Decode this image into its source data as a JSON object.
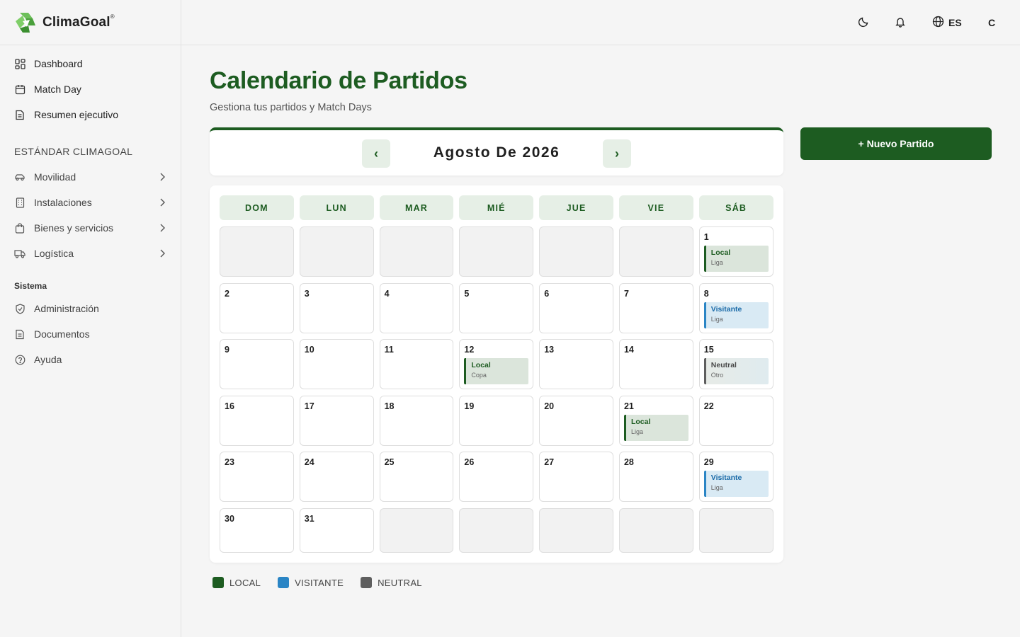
{
  "app": {
    "name": "ClimaGoal",
    "reg_mark": "®"
  },
  "colors": {
    "brand_green": "#1d5c21",
    "local": "#1d5c21",
    "visitante": "#2a85c5",
    "neutral": "#5e5e5e"
  },
  "sidebar": {
    "items_top": [
      {
        "label": "Dashboard",
        "icon": "dashboard-grid-icon"
      },
      {
        "label": "Match Day",
        "icon": "calendar-icon"
      },
      {
        "label": "Resumen ejecutivo",
        "icon": "document-icon"
      }
    ],
    "section1": "ESTÁNDAR CLIMAGOAL",
    "items_standard": [
      {
        "label": "Movilidad",
        "icon": "car-icon"
      },
      {
        "label": "Instalaciones",
        "icon": "building-icon"
      },
      {
        "label": "Bienes y servicios",
        "icon": "shopping-bag-icon"
      },
      {
        "label": "Logística",
        "icon": "truck-icon"
      }
    ],
    "section2": "Sistema",
    "items_system": [
      {
        "label": "Administración",
        "icon": "shield-icon"
      },
      {
        "label": "Documentos",
        "icon": "document-icon"
      },
      {
        "label": "Ayuda",
        "icon": "help-circle-icon"
      }
    ]
  },
  "topbar": {
    "theme_icon": "moon-icon",
    "notif_icon": "bell-icon",
    "lang_icon": "globe-icon",
    "lang": "ES",
    "user_initial": "C"
  },
  "page": {
    "title": "Calendario de Partidos",
    "subtitle": "Gestiona tus partidos y Match Days"
  },
  "calendar": {
    "month_label": "Agosto De 2026",
    "prev": "‹",
    "next": "›",
    "new_button": "+ Nuevo Partido",
    "weekdays": [
      "DOM",
      "LUN",
      "MAR",
      "MIÉ",
      "JUE",
      "VIE",
      "SÁB"
    ],
    "leading_empty": 6,
    "days_in_month": 31,
    "trailing_empty": 5,
    "events": {
      "1": {
        "type": "Local",
        "kind": "local",
        "comp": "Liga"
      },
      "8": {
        "type": "Visitante",
        "kind": "visitante",
        "comp": "Liga"
      },
      "12": {
        "type": "Local",
        "kind": "local",
        "comp": "Copa"
      },
      "15": {
        "type": "Neutral",
        "kind": "neutral",
        "comp": "Otro"
      },
      "21": {
        "type": "Local",
        "kind": "local",
        "comp": "Liga"
      },
      "29": {
        "type": "Visitante",
        "kind": "visitante",
        "comp": "Liga"
      }
    }
  },
  "legend": [
    {
      "label": "LOCAL",
      "color": "#1d5c21"
    },
    {
      "label": "VISITANTE",
      "color": "#2a85c5"
    },
    {
      "label": "NEUTRAL",
      "color": "#5e5e5e"
    }
  ]
}
